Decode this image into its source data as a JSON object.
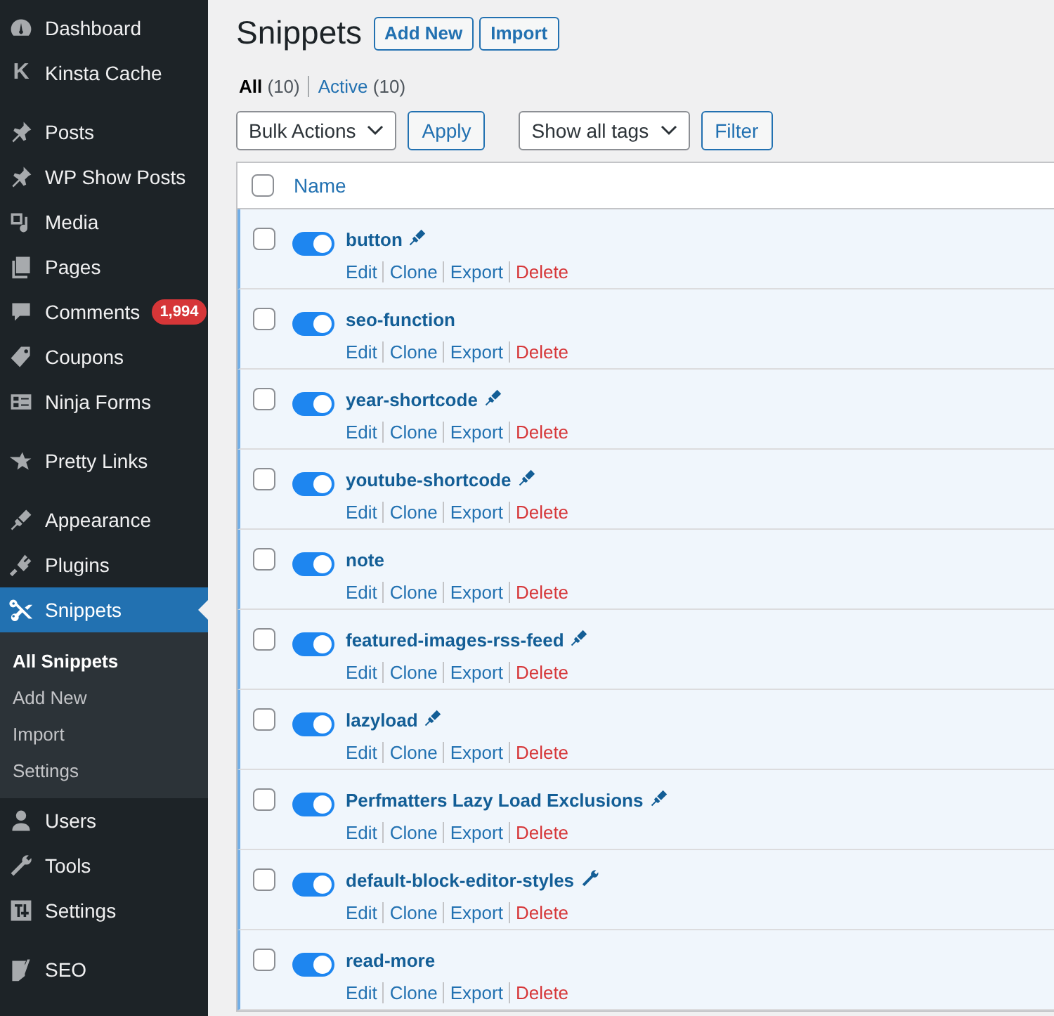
{
  "sidebar": {
    "groups": [
      [
        {
          "label": "Dashboard",
          "selected": false
        },
        {
          "label": "Kinsta Cache",
          "selected": false,
          "icon_text": "K"
        }
      ],
      [
        {
          "label": "Posts",
          "selected": false
        },
        {
          "label": "WP Show Posts",
          "selected": false
        },
        {
          "label": "Media",
          "selected": false
        },
        {
          "label": "Pages",
          "selected": false
        },
        {
          "label": "Comments",
          "selected": false,
          "badge": "1,994"
        },
        {
          "label": "Coupons",
          "selected": false
        },
        {
          "label": "Ninja Forms",
          "selected": false
        }
      ],
      [
        {
          "label": "Pretty Links",
          "selected": false
        }
      ],
      [
        {
          "label": "Appearance",
          "selected": false
        },
        {
          "label": "Plugins",
          "selected": false
        },
        {
          "label": "Snippets",
          "selected": true,
          "children": [
            {
              "label": "All Snippets",
              "selected": true
            },
            {
              "label": "Add New",
              "selected": false
            },
            {
              "label": "Import",
              "selected": false
            },
            {
              "label": "Settings",
              "selected": false
            }
          ]
        },
        {
          "label": "Users",
          "selected": false
        },
        {
          "label": "Tools",
          "selected": false
        },
        {
          "label": "Settings",
          "selected": false
        }
      ],
      [
        {
          "label": "SEO",
          "selected": false
        }
      ]
    ]
  },
  "page": {
    "title": "Snippets",
    "title_buttons": [
      "Add New",
      "Import"
    ],
    "views": [
      {
        "label": "All",
        "count": "(10)",
        "selected": true
      },
      {
        "label": "Active",
        "count": "(10)",
        "selected": false
      }
    ],
    "bulk_select": "Bulk Actions",
    "apply_button": "Apply",
    "tags_select": "Show all tags",
    "filter_button": "Filter"
  },
  "table": {
    "columns": [
      "Name"
    ],
    "select_all_checked": false,
    "rows": [
      {
        "name": "button",
        "checked": false,
        "active": true,
        "kind": "brush",
        "actions": [
          "Edit",
          "Clone",
          "Export",
          "Delete"
        ]
      },
      {
        "name": "seo-function",
        "checked": false,
        "active": true,
        "kind": "plain",
        "actions": [
          "Edit",
          "Clone",
          "Export",
          "Delete"
        ]
      },
      {
        "name": "year-shortcode",
        "checked": false,
        "active": true,
        "kind": "brush",
        "actions": [
          "Edit",
          "Clone",
          "Export",
          "Delete"
        ]
      },
      {
        "name": "youtube-shortcode",
        "checked": false,
        "active": true,
        "kind": "brush",
        "actions": [
          "Edit",
          "Clone",
          "Export",
          "Delete"
        ]
      },
      {
        "name": "note",
        "checked": false,
        "active": true,
        "kind": "plain",
        "actions": [
          "Edit",
          "Clone",
          "Export",
          "Delete"
        ]
      },
      {
        "name": "featured-images-rss-feed",
        "checked": false,
        "active": true,
        "kind": "brush",
        "actions": [
          "Edit",
          "Clone",
          "Export",
          "Delete"
        ]
      },
      {
        "name": "lazyload",
        "checked": false,
        "active": true,
        "kind": "brush",
        "actions": [
          "Edit",
          "Clone",
          "Export",
          "Delete"
        ]
      },
      {
        "name": "Perfmatters Lazy Load Exclusions",
        "checked": false,
        "active": true,
        "kind": "brush",
        "actions": [
          "Edit",
          "Clone",
          "Export",
          "Delete"
        ]
      },
      {
        "name": "default-block-editor-styles",
        "checked": false,
        "active": true,
        "kind": "wrench",
        "actions": [
          "Edit",
          "Clone",
          "Export",
          "Delete"
        ]
      },
      {
        "name": "read-more",
        "checked": false,
        "active": true,
        "kind": "plain",
        "actions": [
          "Edit",
          "Clone",
          "Export",
          "Delete"
        ]
      }
    ]
  }
}
